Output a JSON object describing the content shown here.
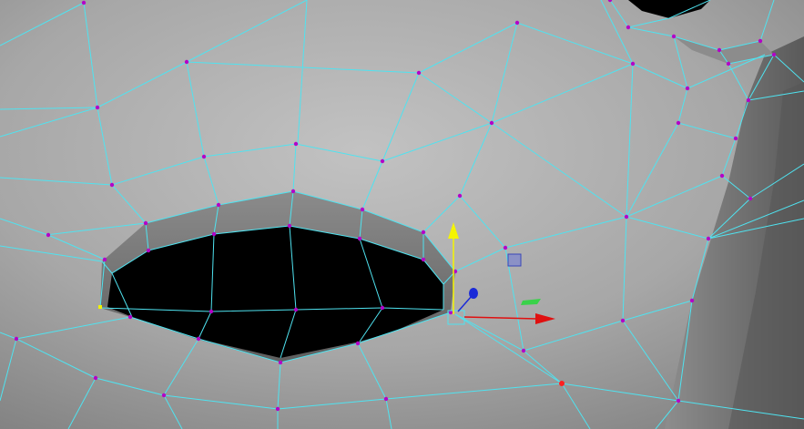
{
  "viewport": {
    "colors": {
      "wireframe": "#4fe3f0",
      "vertex": "#b300c8",
      "selected_vertex": "#ff2020",
      "pivot_vertex": "#f2f200",
      "surface_light": "#b9b9b9",
      "surface_mid": "#9a9a9a",
      "surface_dark": "#6c6c6c",
      "hole": "#000000",
      "axis_x": "#e01010",
      "axis_y": "#f5f500",
      "axis_z": "#1a2ad8",
      "plane_handle_blue": "#6e78d8",
      "plane_handle_green": "#39d24a"
    },
    "icons": {
      "move_gizmo": "move-tool-manipulator",
      "x_handle": "arrow-right-icon",
      "y_handle": "arrow-up-icon",
      "z_handle": "sphere-handle-icon"
    }
  }
}
